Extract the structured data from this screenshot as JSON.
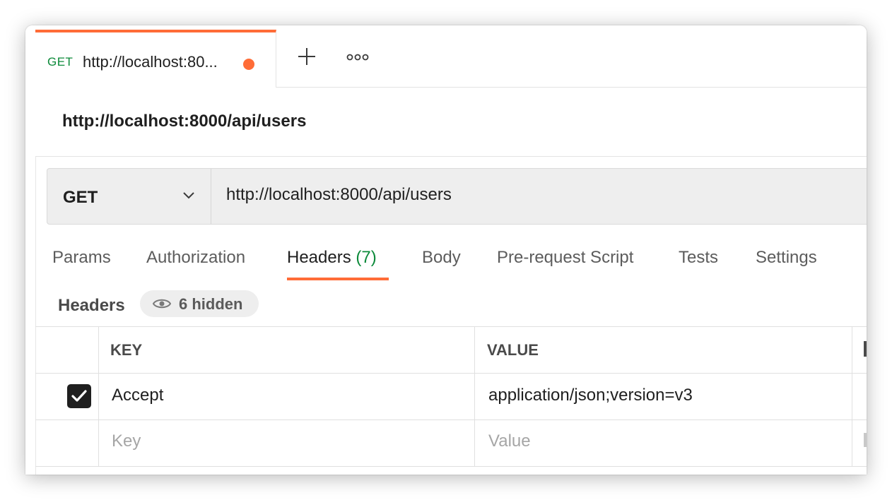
{
  "tab": {
    "method": "GET",
    "title": "http://localhost:80...",
    "unsaved_color": "#ff6c37"
  },
  "tabbar": {
    "add_icon": "plus-icon",
    "more_icon": "more-horizontal-icon"
  },
  "request": {
    "name": "http://localhost:8000/api/users",
    "method": "GET",
    "url": "http://localhost:8000/api/users"
  },
  "subtabs": [
    {
      "label": "Params"
    },
    {
      "label": "Authorization"
    },
    {
      "label": "Headers",
      "count": "(7)"
    },
    {
      "label": "Body"
    },
    {
      "label": "Pre-request Script"
    },
    {
      "label": "Tests"
    },
    {
      "label": "Settings"
    }
  ],
  "headers_section": {
    "label": "Headers",
    "hidden_text": "6 hidden"
  },
  "table": {
    "columns": [
      "KEY",
      "VALUE"
    ],
    "rows": [
      {
        "checked": true,
        "key": "Accept",
        "value": "application/json;version=v3"
      }
    ],
    "placeholder": {
      "key": "Key",
      "value": "Value"
    }
  },
  "colors": {
    "accent": "#ff6c37",
    "method_get": "#0c8a3a"
  }
}
